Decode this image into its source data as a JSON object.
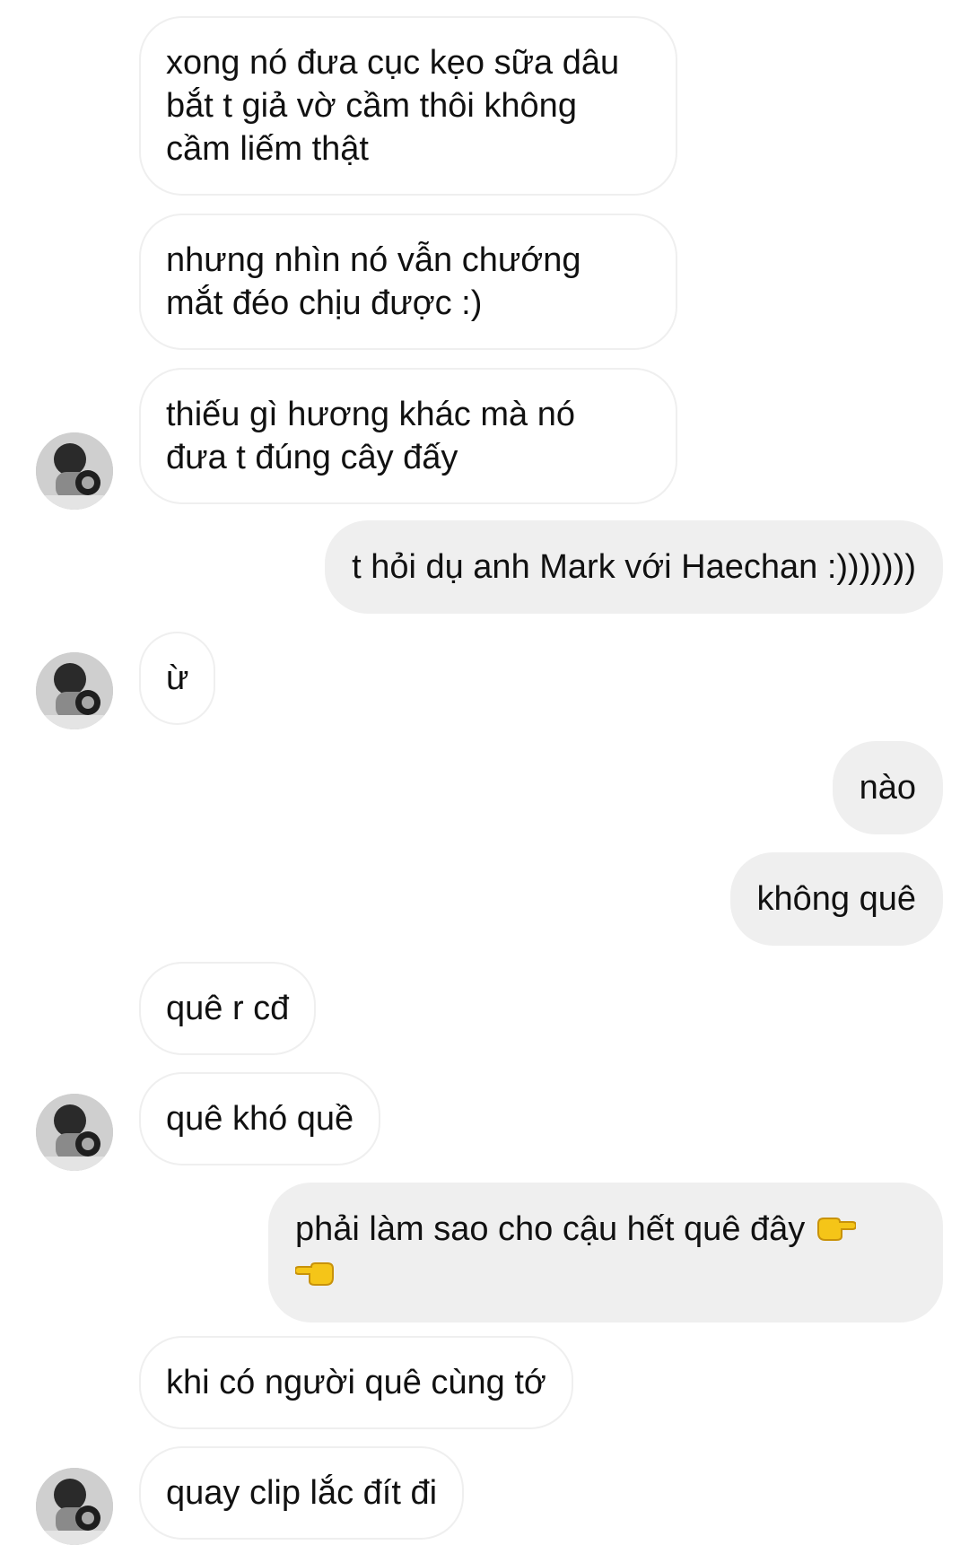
{
  "conversation": {
    "messages": [
      {
        "from": "other",
        "text": "xong nó đưa cục kẹo sữa dâu\nbắt t giả vờ cầm thôi không\ncầm liếm thật"
      },
      {
        "from": "other",
        "text": "nhưng nhìn nó vẫn chướng\nmắt đéo chịu được :)"
      },
      {
        "from": "other",
        "text": "thiếu gì hương khác mà nó\nđưa t đúng cây đấy"
      },
      {
        "from": "me",
        "text": "t hỏi dụ anh Mark với Haechan :)))))))"
      },
      {
        "from": "other",
        "text": "ừ"
      },
      {
        "from": "me",
        "text": "nào"
      },
      {
        "from": "me",
        "text": "không quê"
      },
      {
        "from": "other",
        "text": "quê r cđ"
      },
      {
        "from": "other",
        "text": "quê khó quề"
      },
      {
        "from": "me",
        "text": "phải làm sao cho cậu hết quê đây",
        "emoji": [
          "backhand-index-pointing-right",
          "backhand-index-pointing-left"
        ]
      },
      {
        "from": "other",
        "text": "khi có người quê cùng tớ"
      },
      {
        "from": "other",
        "text": "quay clip lắc đít đi"
      }
    ]
  },
  "colors": {
    "incoming_bubble": "#ffffff",
    "incoming_border": "#efefef",
    "outgoing_bubble": "#efefef",
    "text": "#111111",
    "emoji": "#f5c518"
  },
  "avatar": {
    "icon": "profile-photo-avatar"
  }
}
